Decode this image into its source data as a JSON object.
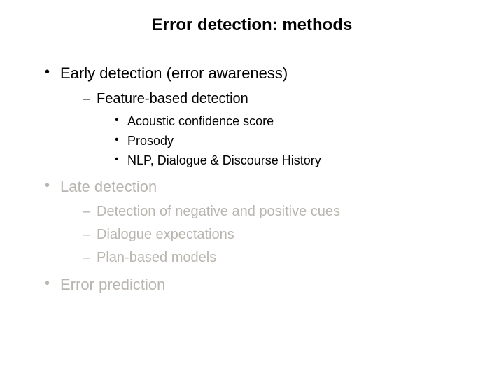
{
  "title": "Error detection: methods",
  "bullets": {
    "b1": "Early detection (error awareness)",
    "b1_1": "Feature-based detection",
    "b1_1_1": "Acoustic confidence score",
    "b1_1_2": "Prosody",
    "b1_1_3": "NLP, Dialogue & Discourse History",
    "b2": "Late detection",
    "b2_1": "Detection of negative and positive cues",
    "b2_2": "Dialogue expectations",
    "b2_3": "Plan-based models",
    "b3": "Error prediction"
  }
}
